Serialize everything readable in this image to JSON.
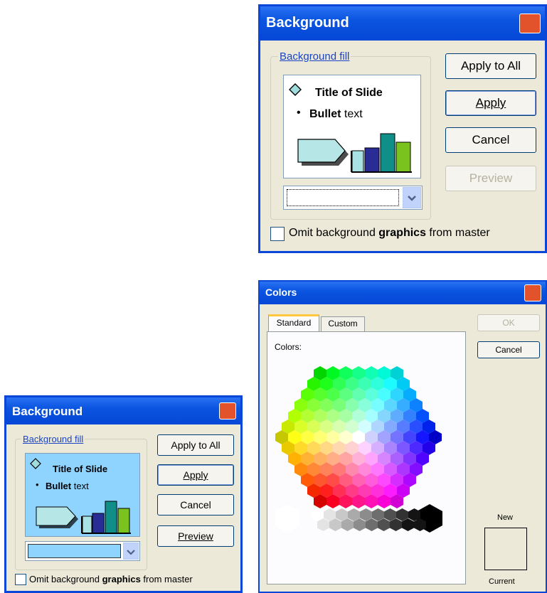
{
  "dialog_large": {
    "title": "Background",
    "group_label": "Background fill",
    "slide_title": "Title of Slide",
    "bullet_bold": "Bullet",
    "bullet_rest": " text",
    "buttons": {
      "apply_all": "Apply to All",
      "apply": "Apply",
      "cancel": "Cancel",
      "preview": "Preview"
    },
    "omit_bold_a": "Omit background ",
    "omit_bold_b": "graphics",
    "omit_rest": " from master",
    "omit_checked": false,
    "fill_color": "#ffffff"
  },
  "dialog_small": {
    "title": "Background",
    "group_label": "Background fill",
    "slide_title": "Title of Slide",
    "bullet_bold": "Bullet",
    "bullet_rest": " text",
    "buttons": {
      "apply_all": "Apply to All",
      "apply": "Apply",
      "cancel": "Cancel",
      "preview": "Preview"
    },
    "omit_bold_a": "Omit background ",
    "omit_bold_b": "graphics",
    "omit_rest": " from master",
    "omit_checked": false,
    "fill_color": "#8fd3ff"
  },
  "colors_dialog": {
    "title": "Colors",
    "tabs": [
      "Standard",
      "Custom"
    ],
    "active_tab": "Standard",
    "colors_label": "Colors:",
    "ok": "OK",
    "cancel": "Cancel",
    "new_label": "New",
    "current_label": "Current",
    "swatch_color": "#ece9d8"
  }
}
